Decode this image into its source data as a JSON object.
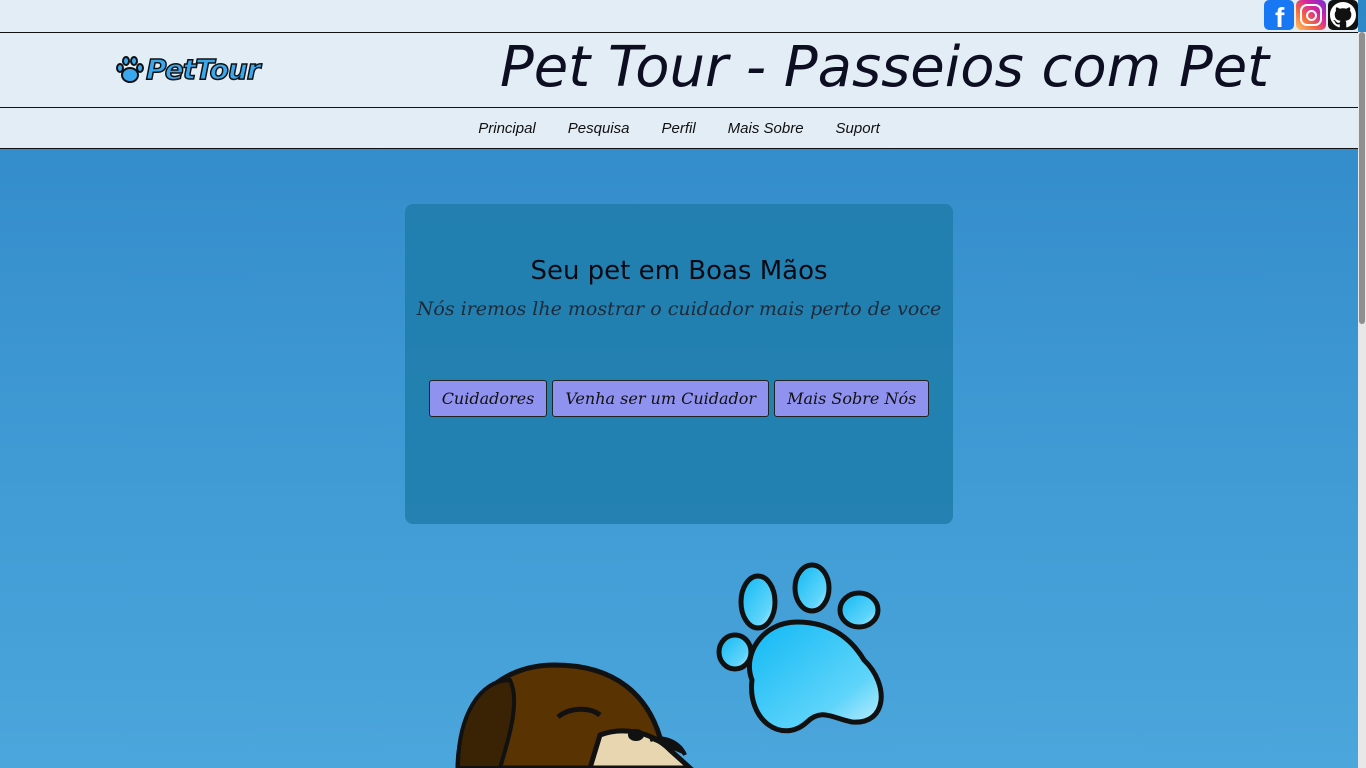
{
  "site": {
    "title": "Pet Tour - Passeios com Pet",
    "logo_text": "PetTour"
  },
  "social": [
    "facebook-icon",
    "instagram-icon",
    "github-icon"
  ],
  "nav": [
    "Principal",
    "Pesquisa",
    "Perfil",
    "Mais Sobre",
    "Suport"
  ],
  "hero": {
    "heading": "Seu pet em Boas Mãos",
    "subtitle": "Nós iremos lhe mostrar o cuidador mais perto de voce",
    "buttons": [
      "Cuidadores",
      "Venha ser um Cuidador",
      "Mais Sobre Nós"
    ]
  },
  "colors": {
    "background": "#3d97d2",
    "button": "#8f93ef",
    "header": "#e3edf5",
    "paw": "#33c4f6"
  }
}
